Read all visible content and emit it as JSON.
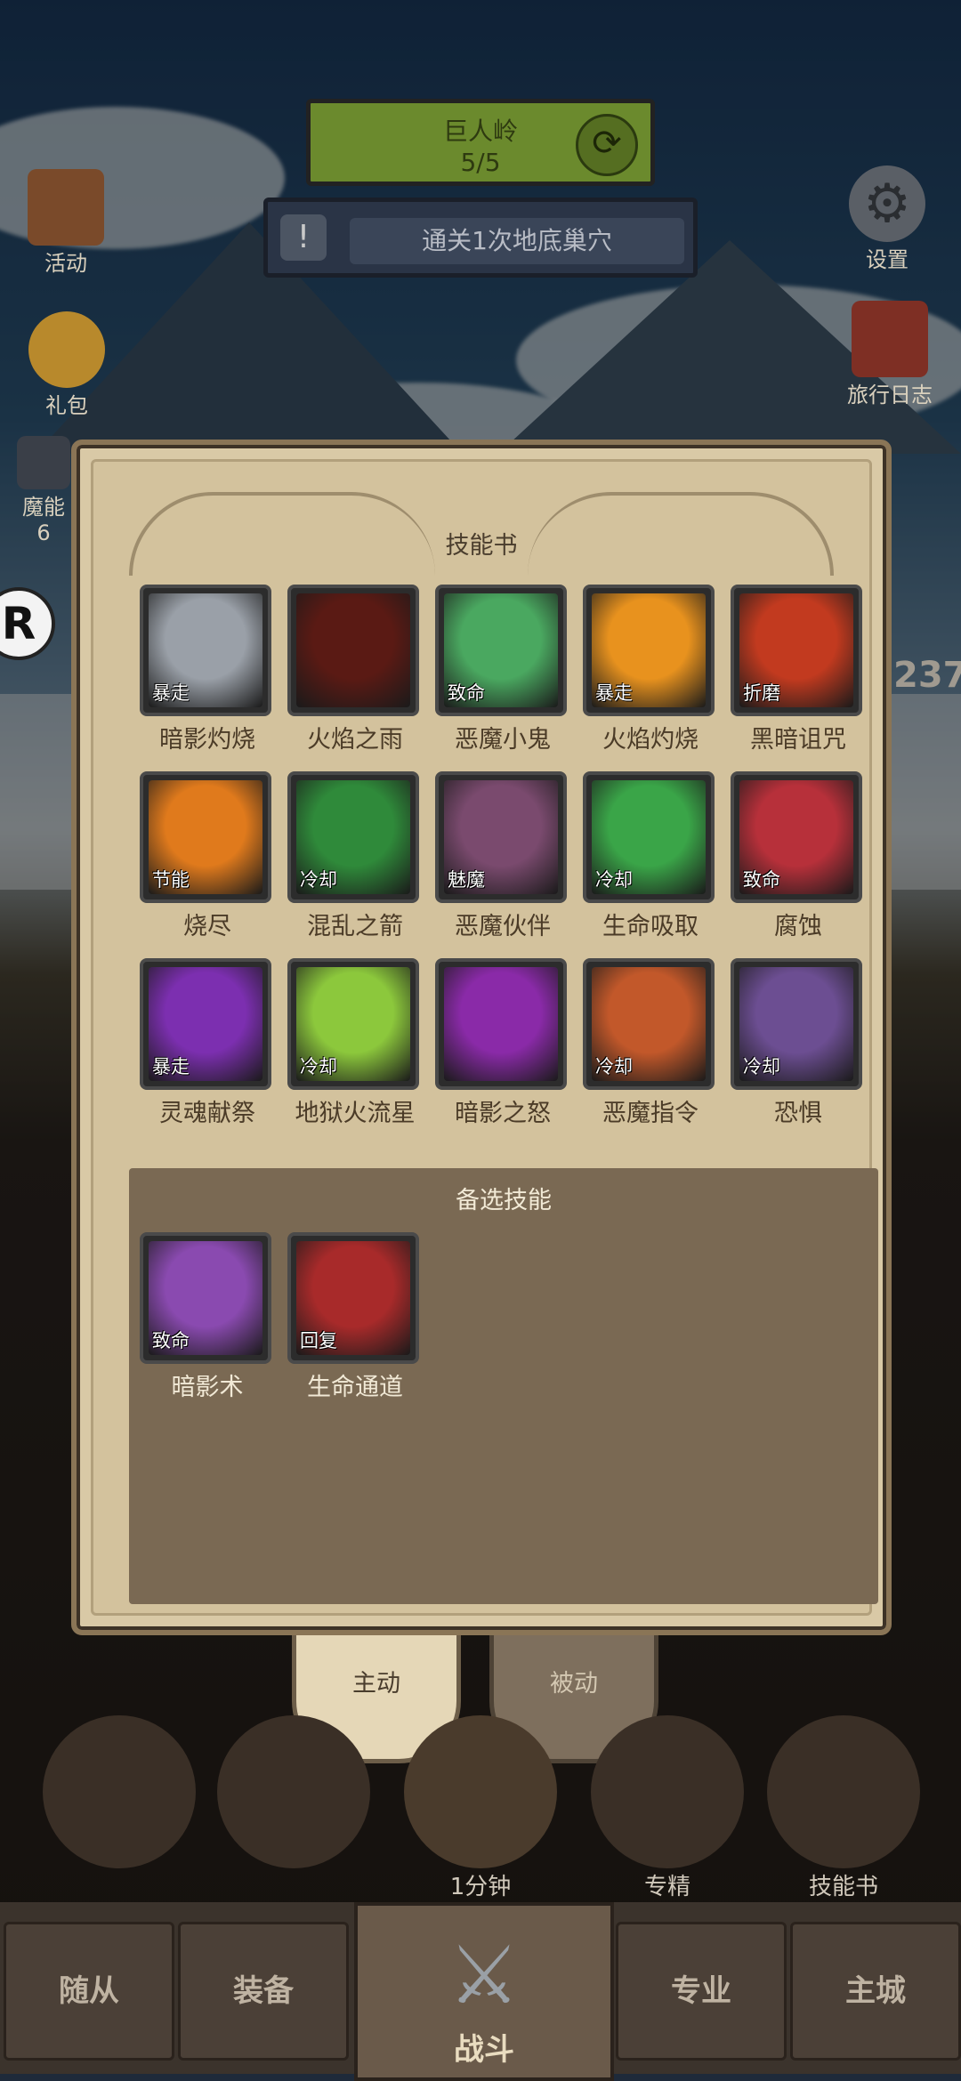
{
  "hud": {
    "quest": {
      "title": "巨人岭",
      "progress": "5/5",
      "refresh_icon": "refresh-icon"
    },
    "task": {
      "text": "通关1次地底巢穴",
      "alert_icon": "!"
    },
    "left_icons": [
      {
        "label": "活动",
        "icon": "scroll-icon"
      },
      {
        "label": "礼包",
        "icon": "coin-icon"
      },
      {
        "label": "魔能",
        "sub": "6",
        "icon": "crystal-icon"
      }
    ],
    "right_icons": [
      {
        "label": "设置",
        "icon": "gear-icon"
      },
      {
        "label": "旅行日志",
        "icon": "book-icon"
      }
    ],
    "side_number": "237",
    "floating_icon": "R"
  },
  "dialog": {
    "title": "技能书",
    "skills": [
      {
        "name": "暗影灼烧",
        "tag": "暴走",
        "color": "#9aa0a8"
      },
      {
        "name": "火焰之雨",
        "tag": "",
        "color": "#5a1a14"
      },
      {
        "name": "恶魔小鬼",
        "tag": "致命",
        "color": "#4aa860"
      },
      {
        "name": "火焰灼烧",
        "tag": "暴走",
        "color": "#e8921e"
      },
      {
        "name": "黑暗诅咒",
        "tag": "折磨",
        "color": "#c23a1f"
      },
      {
        "name": "烧尽",
        "tag": "节能",
        "color": "#e07a1c"
      },
      {
        "name": "混乱之箭",
        "tag": "冷却",
        "color": "#2f8a3a"
      },
      {
        "name": "恶魔伙伴",
        "tag": "魅魔",
        "color": "#7a4a6e"
      },
      {
        "name": "生命吸取",
        "tag": "冷却",
        "color": "#3aa548"
      },
      {
        "name": "腐蚀",
        "tag": "致命",
        "color": "#b7303a"
      },
      {
        "name": "灵魂献祭",
        "tag": "暴走",
        "color": "#7c2fb0"
      },
      {
        "name": "地狱火流星",
        "tag": "冷却",
        "color": "#8cc83c"
      },
      {
        "name": "暗影之怒",
        "tag": "",
        "color": "#8a2aa8"
      },
      {
        "name": "恶魔指令",
        "tag": "冷却",
        "color": "#c2582a"
      },
      {
        "name": "恐惧",
        "tag": "冷却",
        "color": "#6c4e92"
      }
    ],
    "reserve_title": "备选技能",
    "reserve_skills": [
      {
        "name": "暗影术",
        "tag": "致命",
        "color": "#8a4ab0"
      },
      {
        "name": "生命通道",
        "tag": "回复",
        "color": "#a82a2a"
      }
    ]
  },
  "tabs": {
    "active": "主动",
    "inactive": "被动"
  },
  "actions": [
    {
      "label": "",
      "icon": "potion-icon"
    },
    {
      "label": "",
      "icon": "bread-icon"
    },
    {
      "label": "1分钟",
      "icon": "chest-icon"
    },
    {
      "label": "专精",
      "icon": "target-icon"
    },
    {
      "label": "技能书",
      "icon": "skillbook-icon"
    }
  ],
  "nav": {
    "items": [
      "随从",
      "装备",
      "战斗",
      "专业",
      "主城"
    ]
  }
}
